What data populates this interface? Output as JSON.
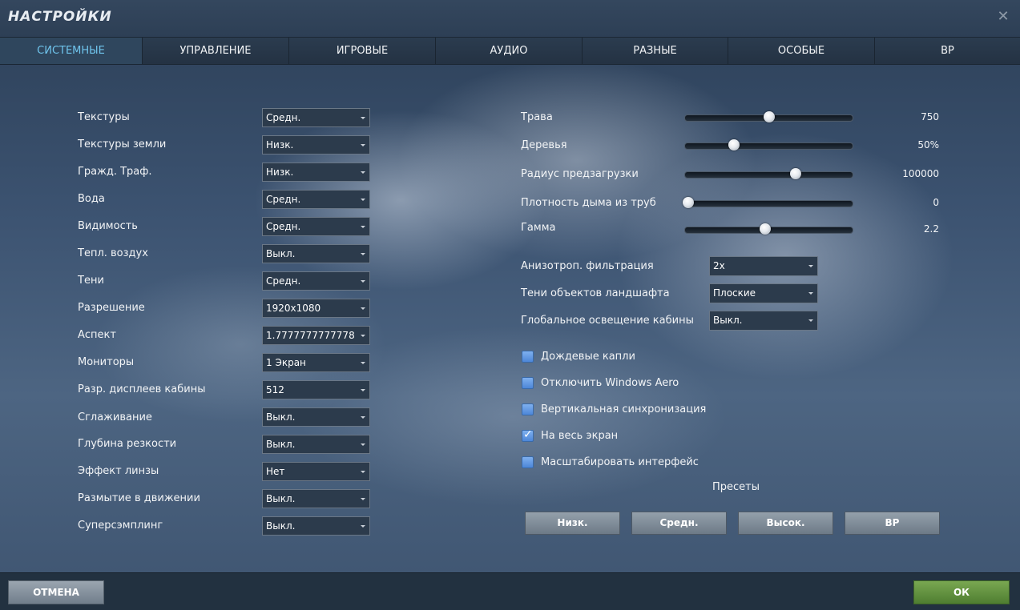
{
  "window": {
    "title": "НАСТРОЙКИ",
    "close_glyph": "✕"
  },
  "tabs": [
    {
      "label": "СИСТЕМНЫЕ",
      "active": true
    },
    {
      "label": "УПРАВЛЕНИЕ"
    },
    {
      "label": "ИГРОВЫЕ"
    },
    {
      "label": "АУДИО"
    },
    {
      "label": "РАЗНЫЕ"
    },
    {
      "label": "ОСОБЫЕ"
    },
    {
      "label": "ВР"
    }
  ],
  "left_settings": [
    {
      "label": "Текстуры",
      "value": "Средн."
    },
    {
      "label": "Текстуры земли",
      "value": "Низк."
    },
    {
      "label": "Гражд. Траф.",
      "value": "Низк."
    },
    {
      "label": "Вода",
      "value": "Средн."
    },
    {
      "label": "Видимость",
      "value": "Средн."
    },
    {
      "label": "Тепл. воздух",
      "value": "Выкл."
    },
    {
      "label": "Тени",
      "value": "Средн."
    },
    {
      "label": "Разрешение",
      "value": "1920x1080"
    },
    {
      "label": "Аспект",
      "value": "1.7777777777778"
    },
    {
      "label": "Мониторы",
      "value": "1 Экран"
    },
    {
      "label": "Разр. дисплеев кабины",
      "value": "512"
    },
    {
      "label": "Сглаживание",
      "value": "Выкл."
    },
    {
      "label": "Глубина резкости",
      "value": "Выкл."
    },
    {
      "label": "Эффект линзы",
      "value": "Нет"
    },
    {
      "label": "Размытие в движении",
      "value": "Выкл."
    },
    {
      "label": "Суперсэмплинг",
      "value": "Выкл."
    }
  ],
  "sliders": [
    {
      "label": "Трава",
      "value": "750",
      "level": 0.5
    },
    {
      "label": "Деревья",
      "value": "50%",
      "level": 0.29
    },
    {
      "label": "Радиус предзагрузки",
      "value": "100000",
      "level": 0.66
    },
    {
      "label": "Плотность дыма из труб",
      "value": "0",
      "level": 0.02
    },
    {
      "label": "Гамма",
      "value": "2.2",
      "level": 0.48
    }
  ],
  "right_selects": [
    {
      "label": "Анизотроп. фильтрация",
      "value": "2x"
    },
    {
      "label": "Тени объектов ландшафта",
      "value": "Плоские"
    },
    {
      "label": "Глобальное освещение кабины",
      "value": "Выкл."
    }
  ],
  "checkboxes": [
    {
      "label": "Дождевые капли",
      "checked": false
    },
    {
      "label": "Отключить Windows Aero",
      "checked": false
    },
    {
      "label": "Вертикальная синхронизация",
      "checked": false
    },
    {
      "label": "На весь экран",
      "checked": true
    },
    {
      "label": "Масштабировать интерфейс",
      "checked": false
    }
  ],
  "presets": {
    "title": "Пресеты",
    "buttons": [
      "Низк.",
      "Средн.",
      "Высок.",
      "ВР"
    ]
  },
  "footer": {
    "cancel": "ОТМЕНА",
    "ok": "ОК"
  },
  "colors": {
    "active_tab_text": "#6fc4ec",
    "ok_button": "#5f8f3d",
    "checkbox": "#5a93e0"
  }
}
